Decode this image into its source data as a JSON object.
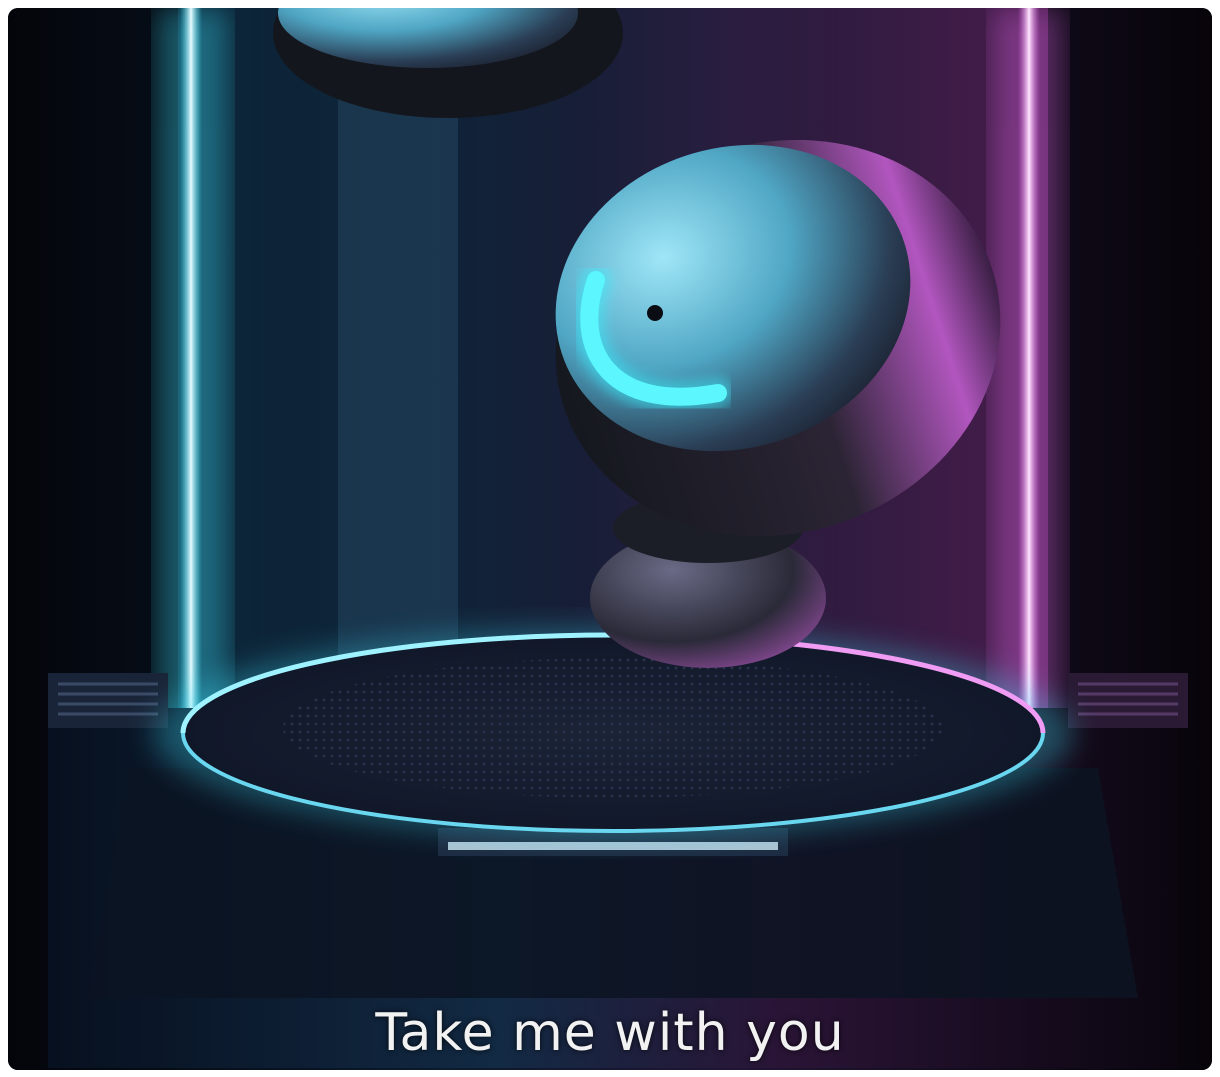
{
  "image": {
    "caption": "Take me with you",
    "subject": "earbud-product-photo",
    "colors": {
      "background": "#05060c",
      "glow_cyan": "#3fe7ff",
      "glow_magenta": "#d24ddc",
      "earbud_shell": "#7ad2ec",
      "earbud_body": "#1b1e2b",
      "led": "#38f3ff"
    }
  }
}
